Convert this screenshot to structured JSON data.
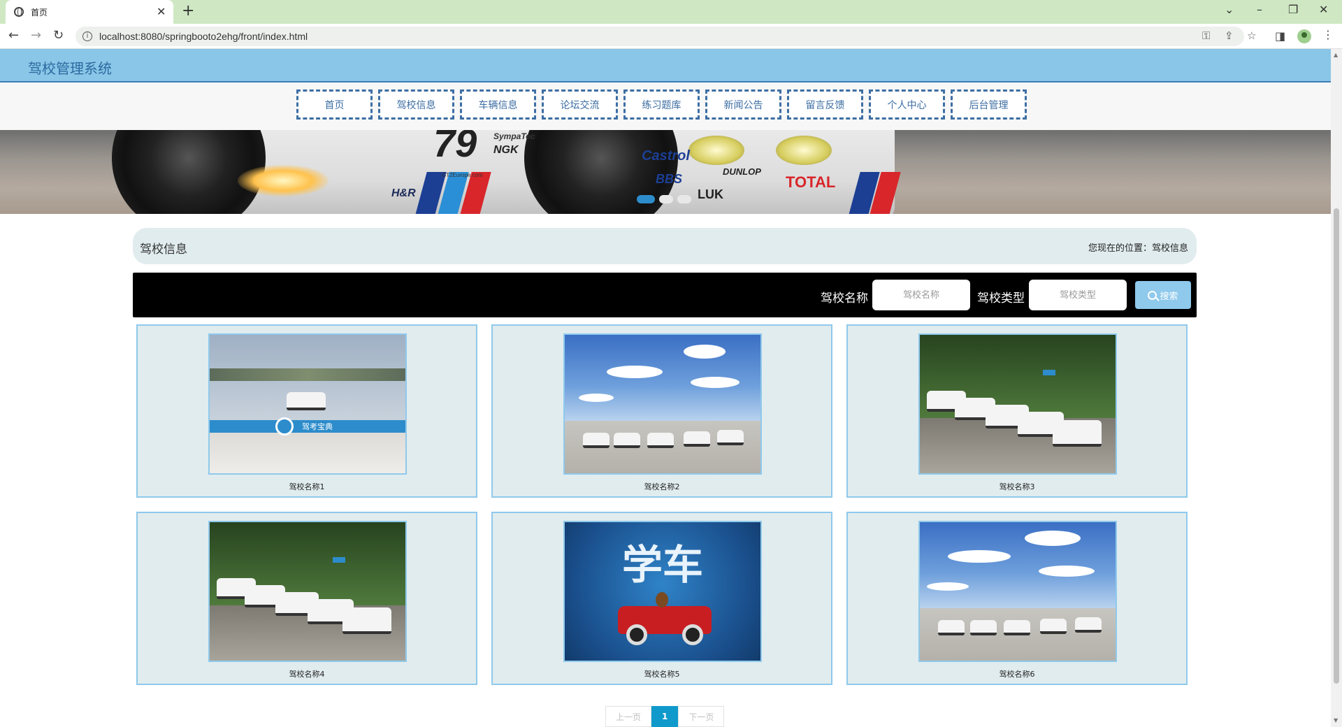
{
  "browser": {
    "tab_title": "首页",
    "url": "localhost:8080/springbooto2ehg/front/index.html"
  },
  "site": {
    "title": "驾校管理系统"
  },
  "nav": {
    "items": [
      "首页",
      "驾校信息",
      "车辆信息",
      "论坛交流",
      "练习题库",
      "新闻公告",
      "留言反馈",
      "个人中心",
      "后台管理"
    ]
  },
  "banner": {
    "slide_count": 3,
    "active_slide": 1,
    "sponsors": [
      "SympaTec",
      "NGK",
      "GT2Europe.com",
      "H&R",
      "Castrol",
      "BBS",
      "DUNLOP",
      "TOTAL",
      "LUK"
    ],
    "car_number": "79"
  },
  "section": {
    "title": "驾校信息",
    "breadcrumb": "您现在的位置：驾校信息"
  },
  "search": {
    "name_label": "驾校名称",
    "name_placeholder": "驾校名称",
    "type_label": "驾校类型",
    "type_placeholder": "驾校类型",
    "button_label": "搜索"
  },
  "cards": [
    {
      "name": "驾校名称1",
      "image": "training-ground",
      "image_caption": "驾考宝典"
    },
    {
      "name": "驾校名称2",
      "image": "cars-under-sky"
    },
    {
      "name": "驾校名称3",
      "image": "cars-row-trees"
    },
    {
      "name": "驾校名称4",
      "image": "cars-row-trees"
    },
    {
      "name": "驾校名称5",
      "image": "learn-driving-poster",
      "image_caption": "学车"
    },
    {
      "name": "驾校名称6",
      "image": "cars-under-sky"
    }
  ],
  "pagination": {
    "prev_label": "上一页",
    "current": "1",
    "next_label": "下一页"
  },
  "colors": {
    "header_bg": "#8ac6e7",
    "nav_border": "#3d6ea3",
    "card_bg": "#e1ecee",
    "card_border": "#8fc9ec",
    "search_bar_bg": "#000000",
    "page_active": "#0f9acb"
  }
}
